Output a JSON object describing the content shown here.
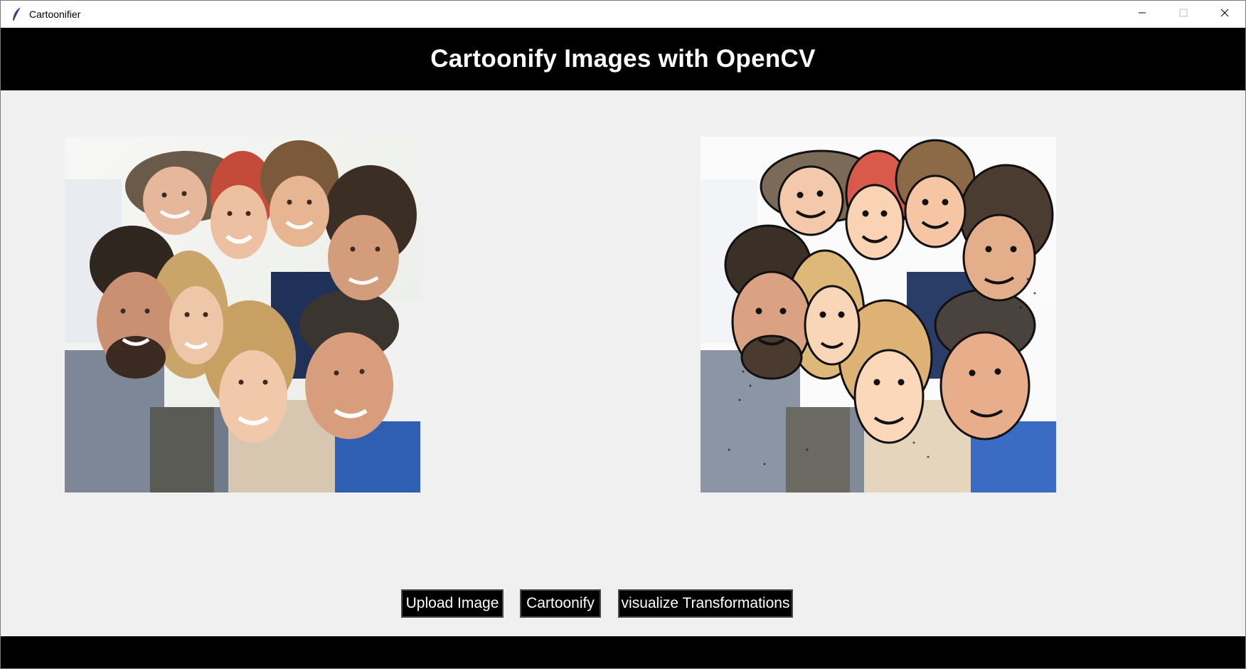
{
  "window": {
    "title": "Cartoonifier",
    "icon": "feather-icon",
    "controls": [
      "minimize-icon",
      "maximize-icon",
      "close-icon"
    ]
  },
  "header": {
    "title": "Cartoonify Images with OpenCV"
  },
  "images": {
    "original": {
      "description_icon": "original-photo"
    },
    "cartoon": {
      "description_icon": "cartoonified-photo"
    }
  },
  "buttons": {
    "upload": "Upload Image",
    "cartoonify": "Cartoonify",
    "visualize": "visualize Transformations"
  },
  "colors": {
    "header_bg": "#000000",
    "header_text": "#ffffff",
    "body_bg": "#f0f0f0",
    "button_bg": "#000000",
    "button_text": "#ffffff",
    "footer_bg": "#000000"
  }
}
